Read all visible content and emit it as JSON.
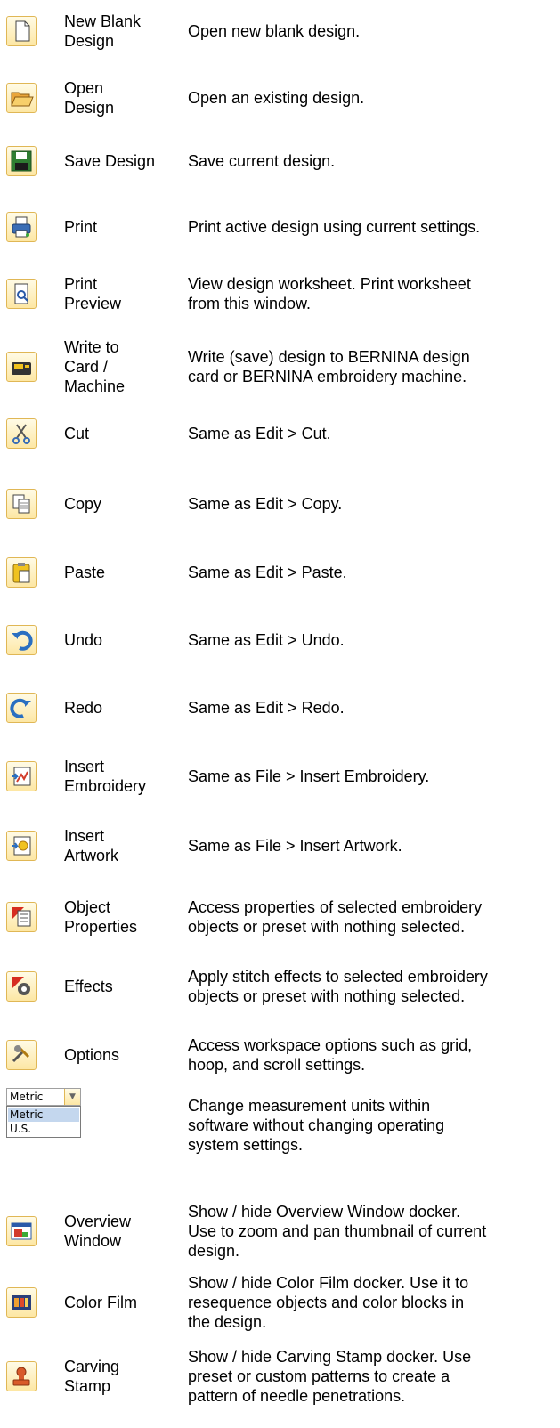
{
  "rows": [
    {
      "name": "New Blank\nDesign",
      "icon": "new-blank-design-icon",
      "desc": "Open new blank design."
    },
    {
      "name": "Open\nDesign",
      "icon": "open-design-icon",
      "desc": "Open an existing design."
    },
    {
      "name": "Save Design",
      "icon": "save-design-icon",
      "desc": "Save current design."
    },
    {
      "name": "Print",
      "icon": "print-icon",
      "desc": "Print active design using current settings."
    },
    {
      "name": "Print\nPreview",
      "icon": "print-preview-icon",
      "desc": "View design worksheet. Print worksheet\nfrom this window."
    },
    {
      "name": "Write to\nCard /\nMachine",
      "icon": "write-to-card-icon",
      "desc": "Write (save) design to BERNINA design\ncard or BERNINA embroidery machine."
    },
    {
      "name": "Cut",
      "icon": "cut-icon",
      "desc": "Same as Edit > Cut."
    },
    {
      "name": "Copy",
      "icon": "copy-icon",
      "desc": "Same as Edit > Copy."
    },
    {
      "name": "Paste",
      "icon": "paste-icon",
      "desc": "Same as Edit > Paste."
    },
    {
      "name": "Undo",
      "icon": "undo-icon",
      "desc": "Same as Edit > Undo."
    },
    {
      "name": "Redo",
      "icon": "redo-icon",
      "desc": "Same as Edit > Redo."
    },
    {
      "name": "Insert\nEmbroidery",
      "icon": "insert-embroidery-icon",
      "desc": "Same as File > Insert Embroidery."
    },
    {
      "name": "Insert\nArtwork",
      "icon": "insert-artwork-icon",
      "desc": "Same as File > Insert Artwork."
    },
    {
      "name": "Object\nProperties",
      "icon": "object-properties-icon",
      "desc": "Access properties of selected embroidery\nobjects or preset with nothing selected."
    },
    {
      "name": "Effects",
      "icon": "effects-icon",
      "desc": "Apply stitch effects to selected embroidery\nobjects or preset with nothing selected."
    },
    {
      "name": "Options",
      "icon": "options-icon",
      "desc": "Access workspace options such as grid,\nhoop, and scroll settings."
    },
    {
      "name": "",
      "icon": "",
      "desc": "Change measurement units within\nsoftware without changing operating\nsystem settings."
    },
    {
      "name": "Overview\nWindow",
      "icon": "overview-window-icon",
      "desc": "Show / hide Overview Window docker.\nUse to zoom and pan thumbnail of current\ndesign."
    },
    {
      "name": "Color Film",
      "icon": "color-film-icon",
      "desc": "Show / hide Color Film docker. Use it to\nresequence objects and color blocks in\nthe design."
    },
    {
      "name": "Carving\nStamp",
      "icon": "carving-stamp-icon",
      "desc": "Show / hide Carving Stamp docker. Use\npreset or custom patterns to create a\npattern of needle penetrations."
    }
  ],
  "units": {
    "selected": "Metric",
    "options": [
      "Metric",
      "U.S."
    ]
  }
}
